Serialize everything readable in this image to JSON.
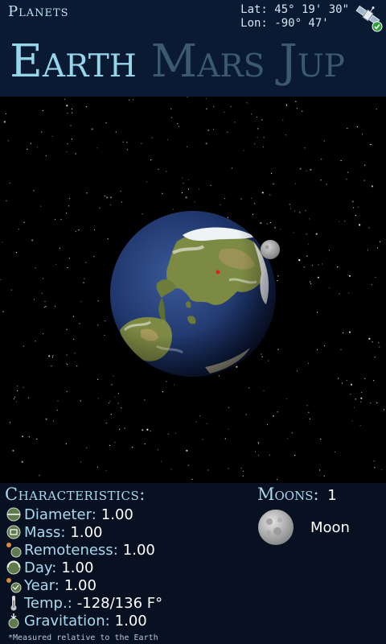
{
  "header": {
    "app_title": "Planets",
    "lat": "Lat: 45° 19' 30\"",
    "lon": "Lon: -90° 47'",
    "tabs": [
      {
        "label": "Earth",
        "active": true
      },
      {
        "label": "Mars",
        "active": false
      },
      {
        "label": "Jup",
        "active": false
      }
    ]
  },
  "info": {
    "characteristics_heading": "Characteristics:",
    "characteristics": [
      {
        "icon": "diameter-icon",
        "label": "Diameter:",
        "value": "1.00"
      },
      {
        "icon": "mass-icon",
        "label": "Mass:",
        "value": "1.00"
      },
      {
        "icon": "remoteness-icon",
        "label": "Remoteness:",
        "value": "1.00"
      },
      {
        "icon": "day-icon",
        "label": "Day:",
        "value": "1.00"
      },
      {
        "icon": "year-icon",
        "label": "Year:",
        "value": "1.00"
      },
      {
        "icon": "thermometer-icon",
        "label": "Temp.:",
        "value": "-128/136 F°"
      },
      {
        "icon": "gravitation-icon",
        "label": "Gravitation:",
        "value": "1.00"
      }
    ],
    "footnote": "*Measured relative to the Earth",
    "moons_heading": "Moons:",
    "moons_count": "1",
    "moons": [
      {
        "name": "Moon"
      }
    ]
  },
  "colors": {
    "accent": "#96d6ea",
    "inactive_tab": "#3b5a72",
    "header_bg": "#0a1a33",
    "panel_bg": "#071122",
    "space_bg": "#000000"
  }
}
